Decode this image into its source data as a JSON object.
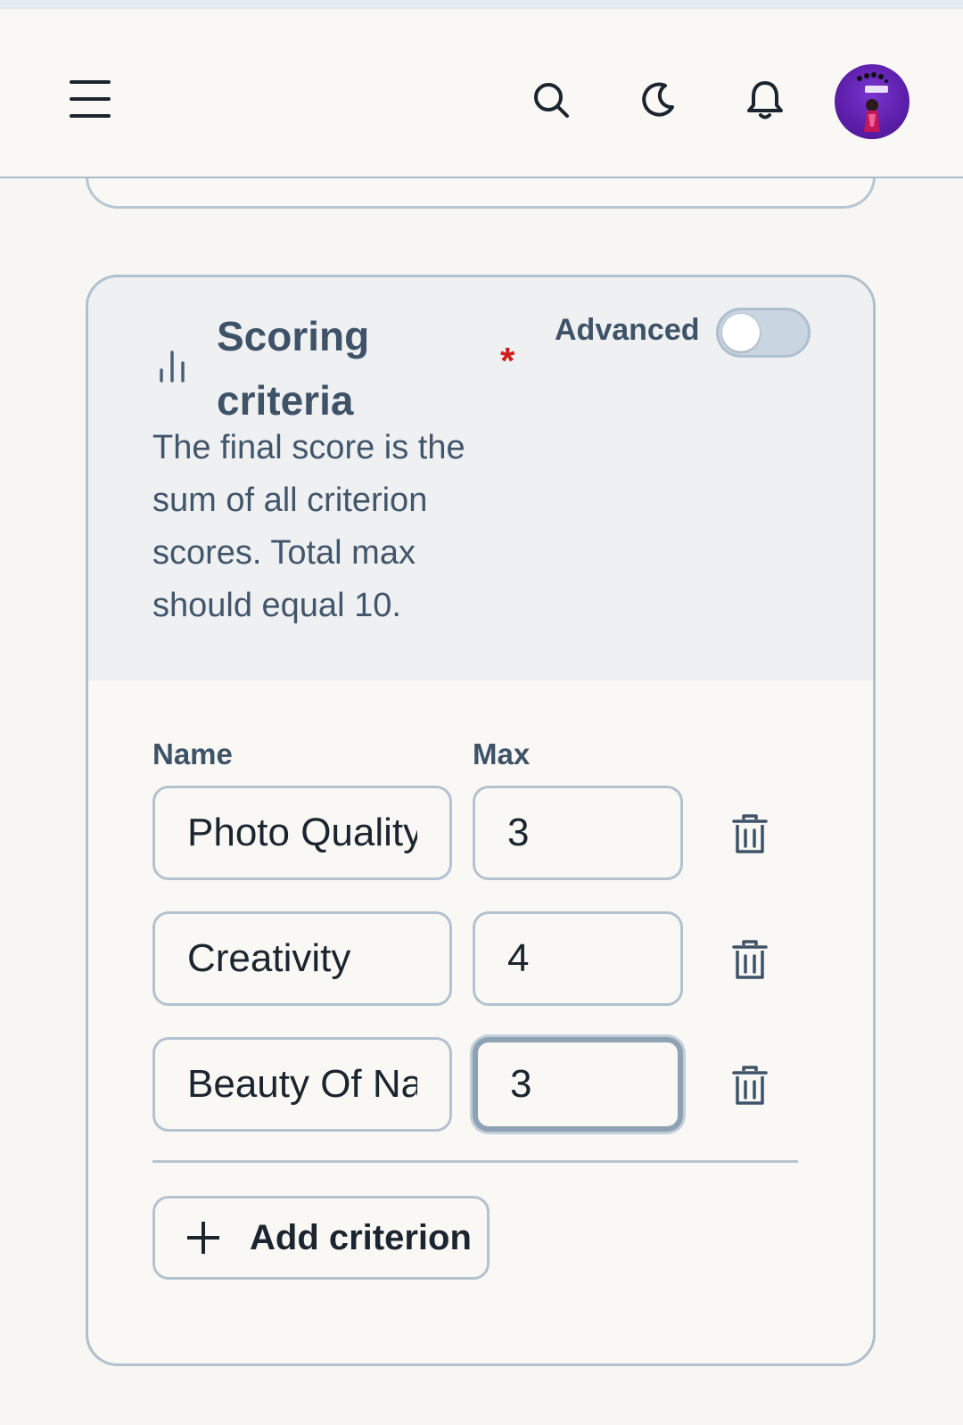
{
  "header": {
    "menu_icon": "hamburger-menu-icon",
    "search_icon": "search-icon",
    "theme_icon": "moon-icon",
    "notifications_icon": "bell-icon",
    "avatar_icon": "user-avatar"
  },
  "scoring": {
    "title": "Scoring criteria",
    "required_marker": "*",
    "advanced_label": "Advanced",
    "advanced_enabled": false,
    "description": "The final score is the sum of all criterion scores. Total max should equal 10.",
    "columns": {
      "name": "Name",
      "max": "Max"
    },
    "criteria": [
      {
        "name": "Photo Quality",
        "max": "3"
      },
      {
        "name": "Creativity",
        "max": "4"
      },
      {
        "name": "Beauty Of Nature",
        "max": "3"
      }
    ],
    "add_label": "Add criterion"
  },
  "colors": {
    "accent_text": "#3e5268",
    "required": "#d21c1c",
    "avatar_bg": "#5b1ea8"
  }
}
